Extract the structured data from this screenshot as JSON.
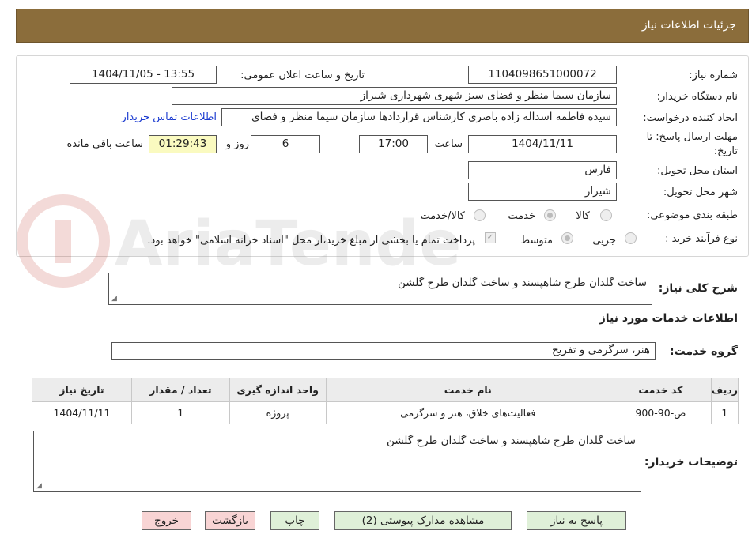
{
  "header": {
    "title": "جزئیات اطلاعات نیاز"
  },
  "form": {
    "need_number_label": "شماره نیاز:",
    "need_number": "1104098651000072",
    "announce_label": "تاریخ و ساعت اعلان عمومی:",
    "announce_value": "1404/11/05 - 13:55",
    "buyer_org_label": "نام دستگاه خریدار:",
    "buyer_org": "سازمان سیما منظر و فضای سبز شهری شهرداری شیراز",
    "requester_label": "ایجاد کننده درخواست:",
    "requester": "سیده فاطمه اسداله زاده باصری کارشناس قراردادها سازمان سیما منظر و فضای",
    "contact_link": "اطلاعات تماس خریدار",
    "deadline_label_1": "مهلت ارسال پاسخ: تا",
    "deadline_label_2": "تاریخ:",
    "deadline_date": "1404/11/11",
    "time_label": "ساعت",
    "deadline_time": "17:00",
    "days_value": "6",
    "days_label": "روز و",
    "remaining_time": "01:29:43",
    "remaining_label": "ساعت باقی مانده",
    "province_label": "استان محل تحویل:",
    "province": "فارس",
    "city_label": "شهر محل تحویل:",
    "city": "شیراز",
    "category_label": "طبقه بندی موضوعی:",
    "category_options": [
      "کالا",
      "خدمت",
      "کالا/خدمت"
    ],
    "category_selected": "خدمت",
    "process_label": "نوع فرآیند خرید :",
    "process_options": [
      "جزیی",
      "متوسط"
    ],
    "process_selected": "متوسط",
    "payment_note": "پرداخت تمام یا بخشی از مبلغ خرید،از محل \"اسناد خزانه اسلامی\" خواهد بود."
  },
  "summary": {
    "label": "شرح کلی نیاز:",
    "text": "ساخت گلدان طرح شاهپسند و ساخت گلدان طرح گلشن"
  },
  "services": {
    "section_title": "اطلاعات خدمات مورد نیاز",
    "group_label": "گروه خدمت:",
    "group_value": "هنر، سرگرمی و تفریح",
    "columns": [
      "ردیف",
      "کد خدمت",
      "نام خدمت",
      "واحد اندازه گیری",
      "تعداد / مقدار",
      "تاریخ نیاز"
    ],
    "rows": [
      [
        "1",
        "ض-90-900",
        "فعالیت‌های خلاق، هنر و سرگرمی",
        "پروژه",
        "1",
        "1404/11/11"
      ]
    ]
  },
  "buyer_notes": {
    "label": "توضیحات خریدار:",
    "text": "ساخت گلدان طرح شاهپسند و ساخت گلدان طرح گلشن"
  },
  "buttons": {
    "reply": "پاسخ به نیاز",
    "attachments": "مشاهده مدارک پیوستی (2)",
    "print": "چاپ",
    "back": "بازگشت",
    "exit": "خروج"
  },
  "watermark": {
    "text": "AriaTender.neT"
  },
  "colors": {
    "header_bg": "#8b6d3b",
    "button_green": "#dff0d8",
    "button_pink": "#f8d4d4",
    "link_blue": "#1a3ad0"
  }
}
